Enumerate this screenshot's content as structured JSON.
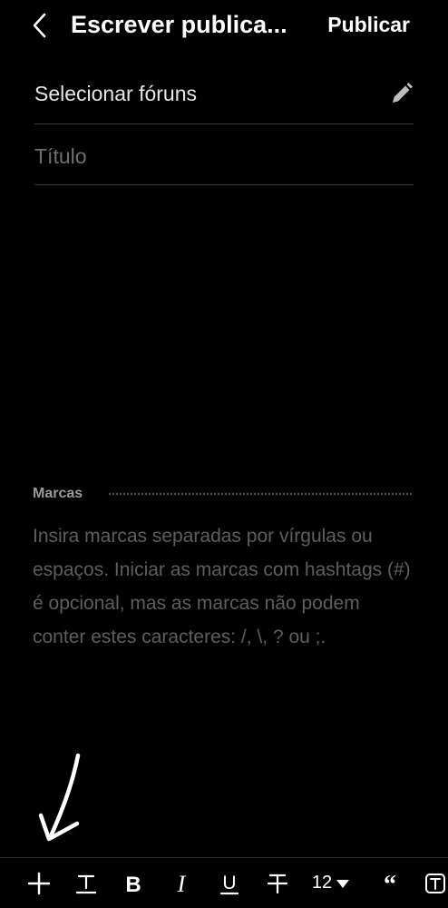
{
  "header": {
    "back_icon": "chevron-left-icon",
    "title": "Escrever publica...",
    "publish_label": "Publicar"
  },
  "forums": {
    "label": "Selecionar fóruns",
    "edit_icon": "pencil-icon"
  },
  "post_title": {
    "placeholder": "Título",
    "value": ""
  },
  "tags": {
    "label": "Marcas",
    "help": "Insira marcas separadas por vírgulas ou espaços. Iniciar as marcas com hashtags (#) é opcional, mas as marcas não podem conter estes caracteres: /, \\, ? ou ;."
  },
  "toolbar": {
    "add_icon": "plus-icon",
    "text_style_icon": "text-style-icon",
    "bold_icon": "bold-icon",
    "italic_icon": "italic-icon",
    "underline_icon": "underline-icon",
    "strikethrough_icon": "strikethrough-icon",
    "font_size": "12",
    "quote_icon": "quote-icon",
    "text_box_icon": "text-box-icon"
  },
  "annotation": {
    "arrow_icon": "hand-drawn-arrow-icon"
  },
  "colors": {
    "background": "#000000",
    "text": "#ffffff",
    "placeholder": "#6f6f6f",
    "divider": "#3a3a3a"
  }
}
